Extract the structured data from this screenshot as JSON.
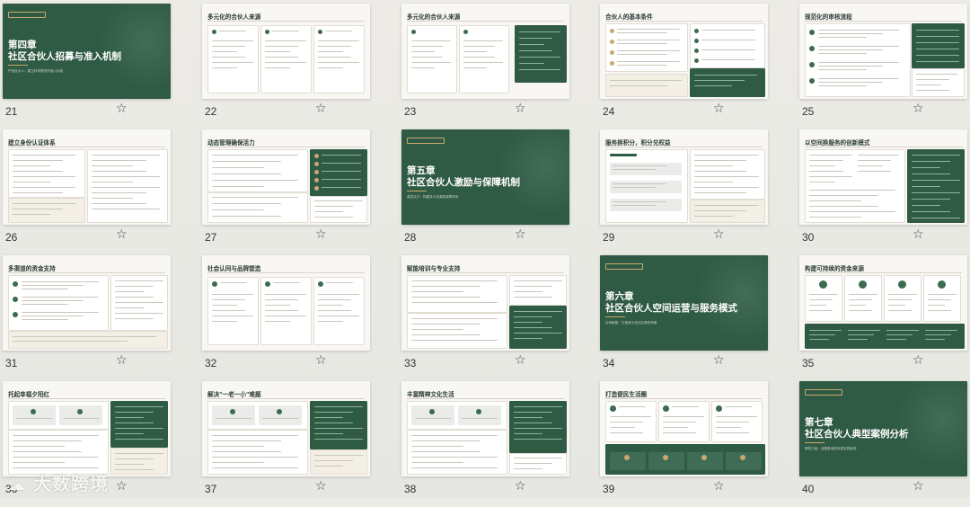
{
  "slides": [
    {
      "num": "21",
      "title": "第四章\n社区合伙人招募与准入机制",
      "subtitle": "严选合伙人：建立科学规范的准入标准",
      "dark": true
    },
    {
      "num": "22",
      "title": "多元化的合伙人来源",
      "dark": false
    },
    {
      "num": "23",
      "title": "多元化的合伙人来源",
      "dark": false
    },
    {
      "num": "24",
      "title": "合伙人的基本条件",
      "dark": false
    },
    {
      "num": "25",
      "title": "规范化的审核流程",
      "dark": false
    },
    {
      "num": "26",
      "title": "建立身份认证体系",
      "dark": false
    },
    {
      "num": "27",
      "title": "动态管理确保活力",
      "dark": false
    },
    {
      "num": "28",
      "title": "第五章\n社区合伙人激励与保障机制",
      "subtitle": "激发活力：构建多元化激励保障体系",
      "dark": true
    },
    {
      "num": "29",
      "title": "服务换积分，积分兑权益",
      "dark": false
    },
    {
      "num": "30",
      "title": "以空间换服务的创新模式",
      "dark": false
    },
    {
      "num": "31",
      "title": "多渠道的资金支持",
      "dark": false
    },
    {
      "num": "32",
      "title": "社会认同与品牌塑造",
      "dark": false
    },
    {
      "num": "33",
      "title": "赋能培训与专业支持",
      "dark": false
    },
    {
      "num": "34",
      "title": "第六章\n社区合伙人空间运营与服务模式",
      "subtitle": "空间赋能：打造多元化社区服务场景",
      "dark": true
    },
    {
      "num": "35",
      "title": "构建可持续的资金来源",
      "dark": false
    },
    {
      "num": "36",
      "title": "托起幸福夕阳红",
      "dark": false
    },
    {
      "num": "37",
      "title": "解决\"一老一小\"难题",
      "dark": false
    },
    {
      "num": "38",
      "title": "丰富精神文化生活",
      "dark": false
    },
    {
      "num": "39",
      "title": "打造便民生活圈",
      "dark": false
    },
    {
      "num": "40",
      "title": "第七章\n社区合伙人典型案例分析",
      "subtitle": "榜样力量：全国各地的优秀实践经验",
      "dark": true
    }
  ],
  "star_icon": "star-outline-icon",
  "watermark": "大数跨境"
}
